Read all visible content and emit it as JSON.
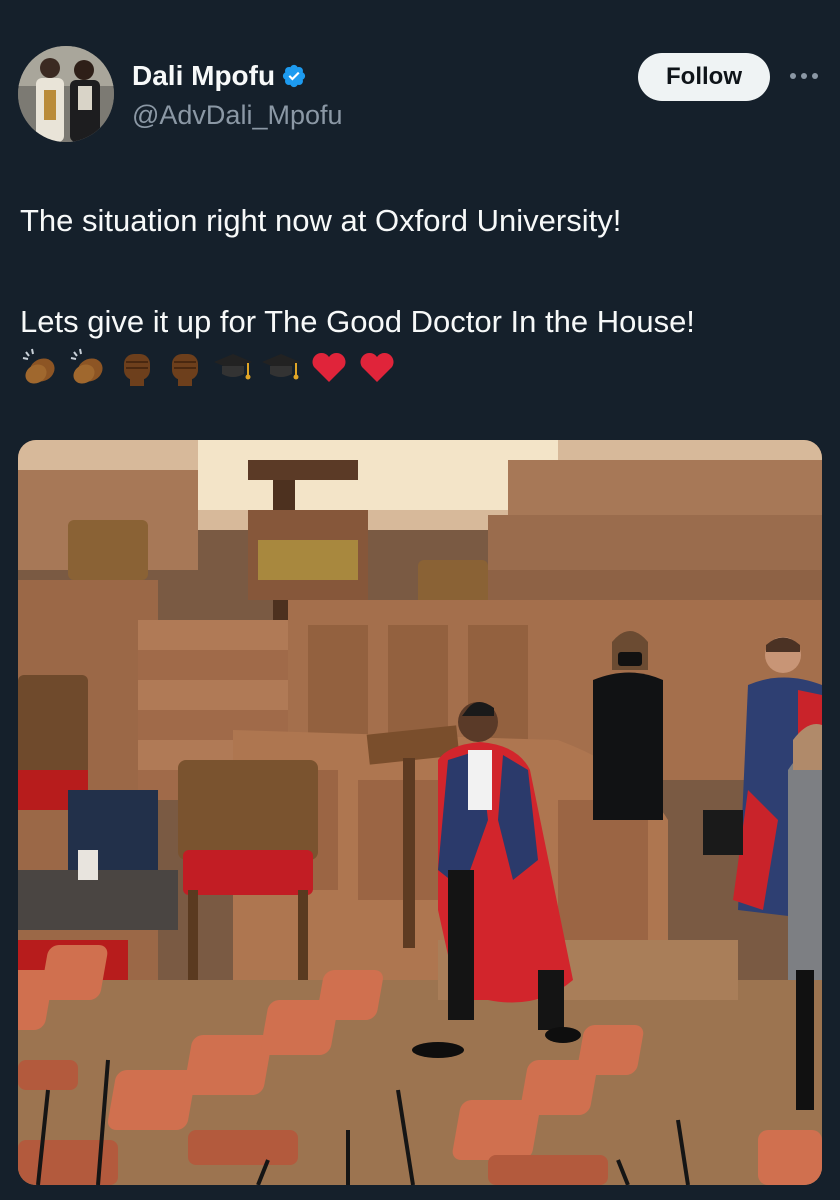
{
  "author": {
    "display_name": "Dali Mpofu",
    "handle": "@AdvDali_Mpofu",
    "verified": true
  },
  "actions": {
    "follow_label": "Follow",
    "more_icon": "more-horizontal-icon"
  },
  "tweet": {
    "line1": "The situation right now at Oxford University!",
    "line2": "Lets give it up for The Good Doctor In the House!",
    "emojis": [
      "clapping-hands-icon",
      "clapping-hands-icon",
      "raised-fist-icon",
      "raised-fist-icon",
      "graduation-cap-icon",
      "graduation-cap-icon",
      "red-heart-icon",
      "red-heart-icon"
    ]
  },
  "media": {
    "kind": "photo",
    "scene": "graduate-in-red-robe-walking-in-wood-panelled-hall"
  },
  "colors": {
    "background": "#15202b",
    "text": "#f7f9f9",
    "secondary_text": "#8b98a5",
    "verified_blue": "#1d9bf0",
    "follow_bg": "#eff3f4"
  }
}
